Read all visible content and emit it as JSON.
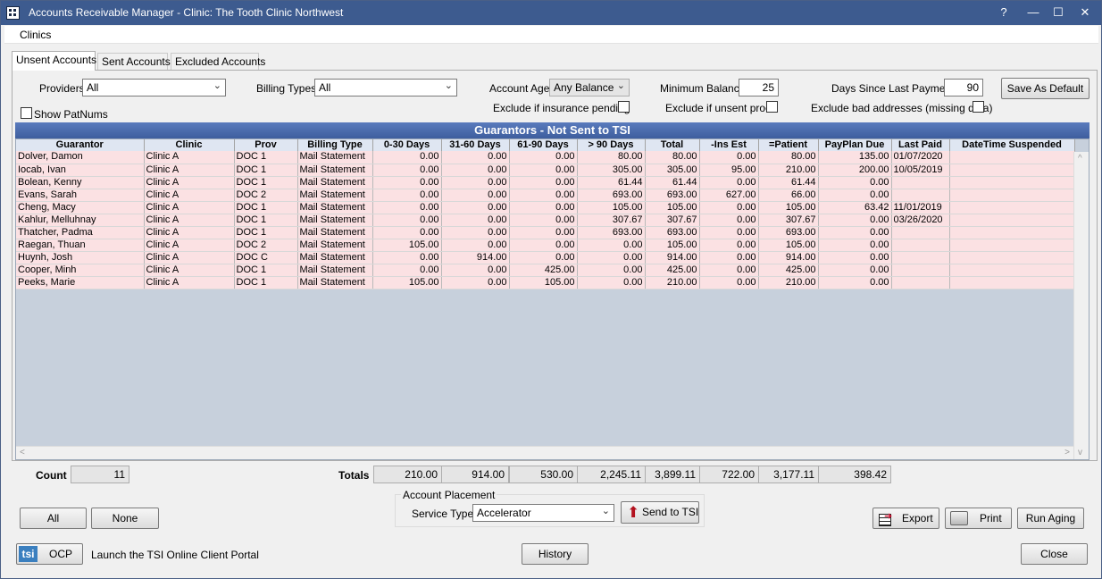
{
  "window": {
    "title": "Accounts Receivable Manager - Clinic: The Tooth Clinic Northwest",
    "controls": {
      "help": "?",
      "minimize": "—",
      "maximize": "☐",
      "close": "✕"
    }
  },
  "menu": {
    "clinics": "Clinics"
  },
  "tabs": [
    {
      "label": "Unsent Accounts"
    },
    {
      "label": "Sent Accounts"
    },
    {
      "label": "Excluded Accounts"
    }
  ],
  "filters": {
    "providers_label": "Providers",
    "providers_value": "All",
    "billing_types_label": "Billing Types",
    "billing_types_value": "All",
    "account_age_label": "Account Age",
    "account_age_value": "Any Balance",
    "min_balance_label": "Minimum Balance",
    "min_balance_value": "25",
    "days_since_label": "Days Since Last Payment",
    "days_since_value": "90",
    "save_default": "Save As Default",
    "show_patnums": "Show PatNums",
    "excl_ins_pending": "Exclude if insurance pending",
    "excl_unsent_procs": "Exclude if unsent procs",
    "excl_bad_addresses": "Exclude bad addresses (missing data)"
  },
  "grid": {
    "title": "Guarantors - Not Sent to TSI",
    "columns": [
      "Guarantor",
      "Clinic",
      "Prov",
      "Billing Type",
      "0-30 Days",
      "31-60 Days",
      "61-90 Days",
      "> 90 Days",
      "Total",
      "-Ins Est",
      "=Patient",
      "PayPlan Due",
      "Last Paid",
      "DateTime Suspended"
    ],
    "rows": [
      [
        "Dolver, Damon",
        "Clinic A",
        "DOC 1",
        "Mail Statement",
        "0.00",
        "0.00",
        "0.00",
        "80.00",
        "80.00",
        "0.00",
        "80.00",
        "135.00",
        "01/07/2020",
        ""
      ],
      [
        "Iocab, Ivan",
        "Clinic A",
        "DOC 1",
        "Mail Statement",
        "0.00",
        "0.00",
        "0.00",
        "305.00",
        "305.00",
        "95.00",
        "210.00",
        "200.00",
        "10/05/2019",
        ""
      ],
      [
        "Bolean, Kenny",
        "Clinic A",
        "DOC 1",
        "Mail Statement",
        "0.00",
        "0.00",
        "0.00",
        "61.44",
        "61.44",
        "0.00",
        "61.44",
        "0.00",
        "",
        ""
      ],
      [
        "Evans, Sarah",
        "Clinic A",
        "DOC 2",
        "Mail Statement",
        "0.00",
        "0.00",
        "0.00",
        "693.00",
        "693.00",
        "627.00",
        "66.00",
        "0.00",
        "",
        ""
      ],
      [
        "Cheng, Macy",
        "Clinic A",
        "DOC 1",
        "Mail Statement",
        "0.00",
        "0.00",
        "0.00",
        "105.00",
        "105.00",
        "0.00",
        "105.00",
        "63.42",
        "11/01/2019",
        ""
      ],
      [
        "Kahlur, Melluhnay",
        "Clinic A",
        "DOC 1",
        "Mail Statement",
        "0.00",
        "0.00",
        "0.00",
        "307.67",
        "307.67",
        "0.00",
        "307.67",
        "0.00",
        "03/26/2020",
        ""
      ],
      [
        "Thatcher, Padma",
        "Clinic A",
        "DOC 1",
        "Mail Statement",
        "0.00",
        "0.00",
        "0.00",
        "693.00",
        "693.00",
        "0.00",
        "693.00",
        "0.00",
        "",
        ""
      ],
      [
        "Raegan, Thuan",
        "Clinic A",
        "DOC 2",
        "Mail Statement",
        "105.00",
        "0.00",
        "0.00",
        "0.00",
        "105.00",
        "0.00",
        "105.00",
        "0.00",
        "",
        ""
      ],
      [
        "Huynh, Josh",
        "Clinic A",
        "DOC C",
        "Mail Statement",
        "0.00",
        "914.00",
        "0.00",
        "0.00",
        "914.00",
        "0.00",
        "914.00",
        "0.00",
        "",
        ""
      ],
      [
        "Cooper, Minh",
        "Clinic A",
        "DOC 1",
        "Mail Statement",
        "0.00",
        "0.00",
        "425.00",
        "0.00",
        "425.00",
        "0.00",
        "425.00",
        "0.00",
        "",
        ""
      ],
      [
        "Peeks, Marie",
        "Clinic A",
        "DOC 1",
        "Mail Statement",
        "105.00",
        "0.00",
        "105.00",
        "0.00",
        "210.00",
        "0.00",
        "210.00",
        "0.00",
        "",
        ""
      ]
    ]
  },
  "totals": {
    "count_label": "Count",
    "count_value": "11",
    "totals_label": "Totals",
    "values": [
      "210.00",
      "914.00",
      "530.00",
      "2,245.11",
      "3,899.11",
      "722.00",
      "3,177.11",
      "398.42"
    ]
  },
  "footer": {
    "all_button": "All",
    "none_button": "None",
    "placement_title": "Account Placement",
    "service_type_label": "Service Type",
    "service_type_value": "Accelerator",
    "send_tsi": "Send to TSI",
    "export": "Export",
    "print": "Print",
    "run_aging": "Run Aging",
    "ocp_logo": "tsi",
    "ocp_button": "OCP",
    "ocp_caption": "Launch the TSI Online Client Portal",
    "history": "History",
    "close": "Close"
  }
}
